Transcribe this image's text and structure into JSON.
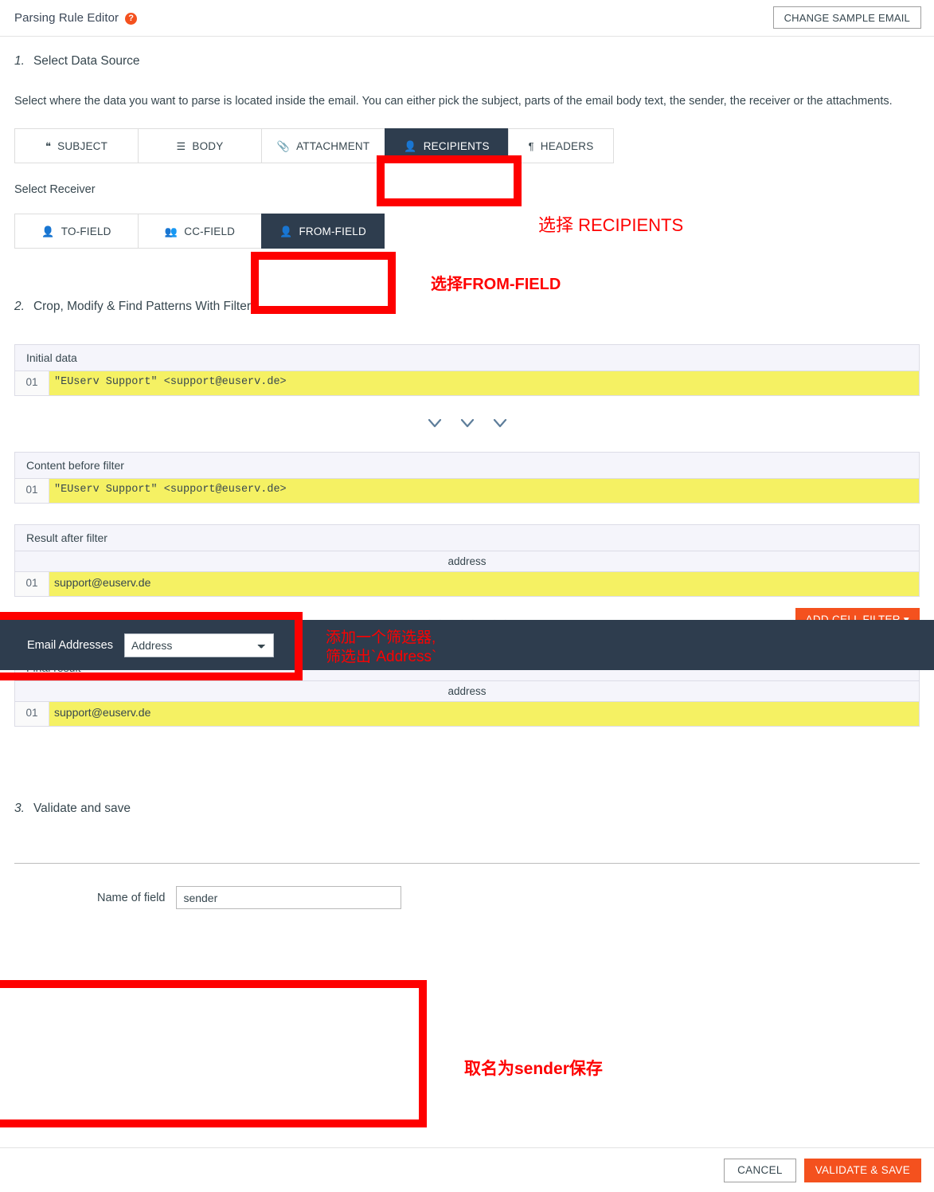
{
  "header": {
    "title": "Parsing Rule Editor",
    "help_icon": "question-mark-icon",
    "change_sample_button": "CHANGE SAMPLE EMAIL"
  },
  "step1": {
    "number": "1.",
    "title": "Select Data Source",
    "description": "Select where the data you want to parse is located inside the email. You can either pick the subject, parts of the email body text, the sender, the receiver or the attachments.",
    "source_tabs": [
      {
        "label": "SUBJECT",
        "icon": "quote-icon",
        "active": false
      },
      {
        "label": "BODY",
        "icon": "lines-icon",
        "active": false
      },
      {
        "label": "ATTACHMENT",
        "icon": "paperclip-icon",
        "active": false
      },
      {
        "label": "RECIPIENTS",
        "icon": "user-icon",
        "active": true
      },
      {
        "label": "HEADERS",
        "icon": "pilcrow-icon",
        "active": false
      }
    ],
    "receiver_label": "Select Receiver",
    "receiver_tabs": [
      {
        "label": "TO-FIELD",
        "icon": "user-icon",
        "active": false
      },
      {
        "label": "CC-FIELD",
        "icon": "users-icon",
        "active": false
      },
      {
        "label": "FROM-FIELD",
        "icon": "user-icon",
        "active": true
      }
    ]
  },
  "step2": {
    "number": "2.",
    "title": "Crop, Modify & Find Patterns With Filters",
    "initial_panel": {
      "heading": "Initial data",
      "rows": [
        {
          "num": "01",
          "text": "\"EUserv Support\" <support@euserv.de>"
        }
      ]
    },
    "before_filter_panel": {
      "heading": "Content before filter",
      "rows": [
        {
          "num": "01",
          "text": "\"EUserv Support\" <support@euserv.de>"
        }
      ]
    },
    "filter_strip": {
      "label": "Email Addresses",
      "select_value": "Address",
      "options": [
        "Address"
      ]
    },
    "after_filter_panel": {
      "heading": "Result after filter",
      "column_header": "address",
      "rows": [
        {
          "num": "01",
          "text": "support@euserv.de"
        }
      ]
    },
    "add_cell_filter_button": "ADD CELL FILTER",
    "add_cell_filter_caret": "▾",
    "final_panel": {
      "heading": "Final result",
      "column_header": "address",
      "rows": [
        {
          "num": "01",
          "text": "support@euserv.de"
        }
      ]
    }
  },
  "step3": {
    "number": "3.",
    "title": "Validate and save",
    "field_label": "Name of field",
    "field_value": "sender",
    "field_placeholder": ""
  },
  "footer": {
    "cancel_button": "CANCEL",
    "save_button": "VALIDATE & SAVE"
  },
  "annotations": [
    {
      "text": "选择 RECIPIENTS"
    },
    {
      "text": "选择FROM-FIELD"
    },
    {
      "text": "添加一个筛选器,\n筛选出`Address`"
    },
    {
      "text": "取名为sender保存"
    }
  ],
  "colors": {
    "accent_orange": "#f4511e",
    "dark_navy": "#2e3d4e",
    "row_yellow": "#f5f163",
    "annotation_red": "#fe0000"
  }
}
